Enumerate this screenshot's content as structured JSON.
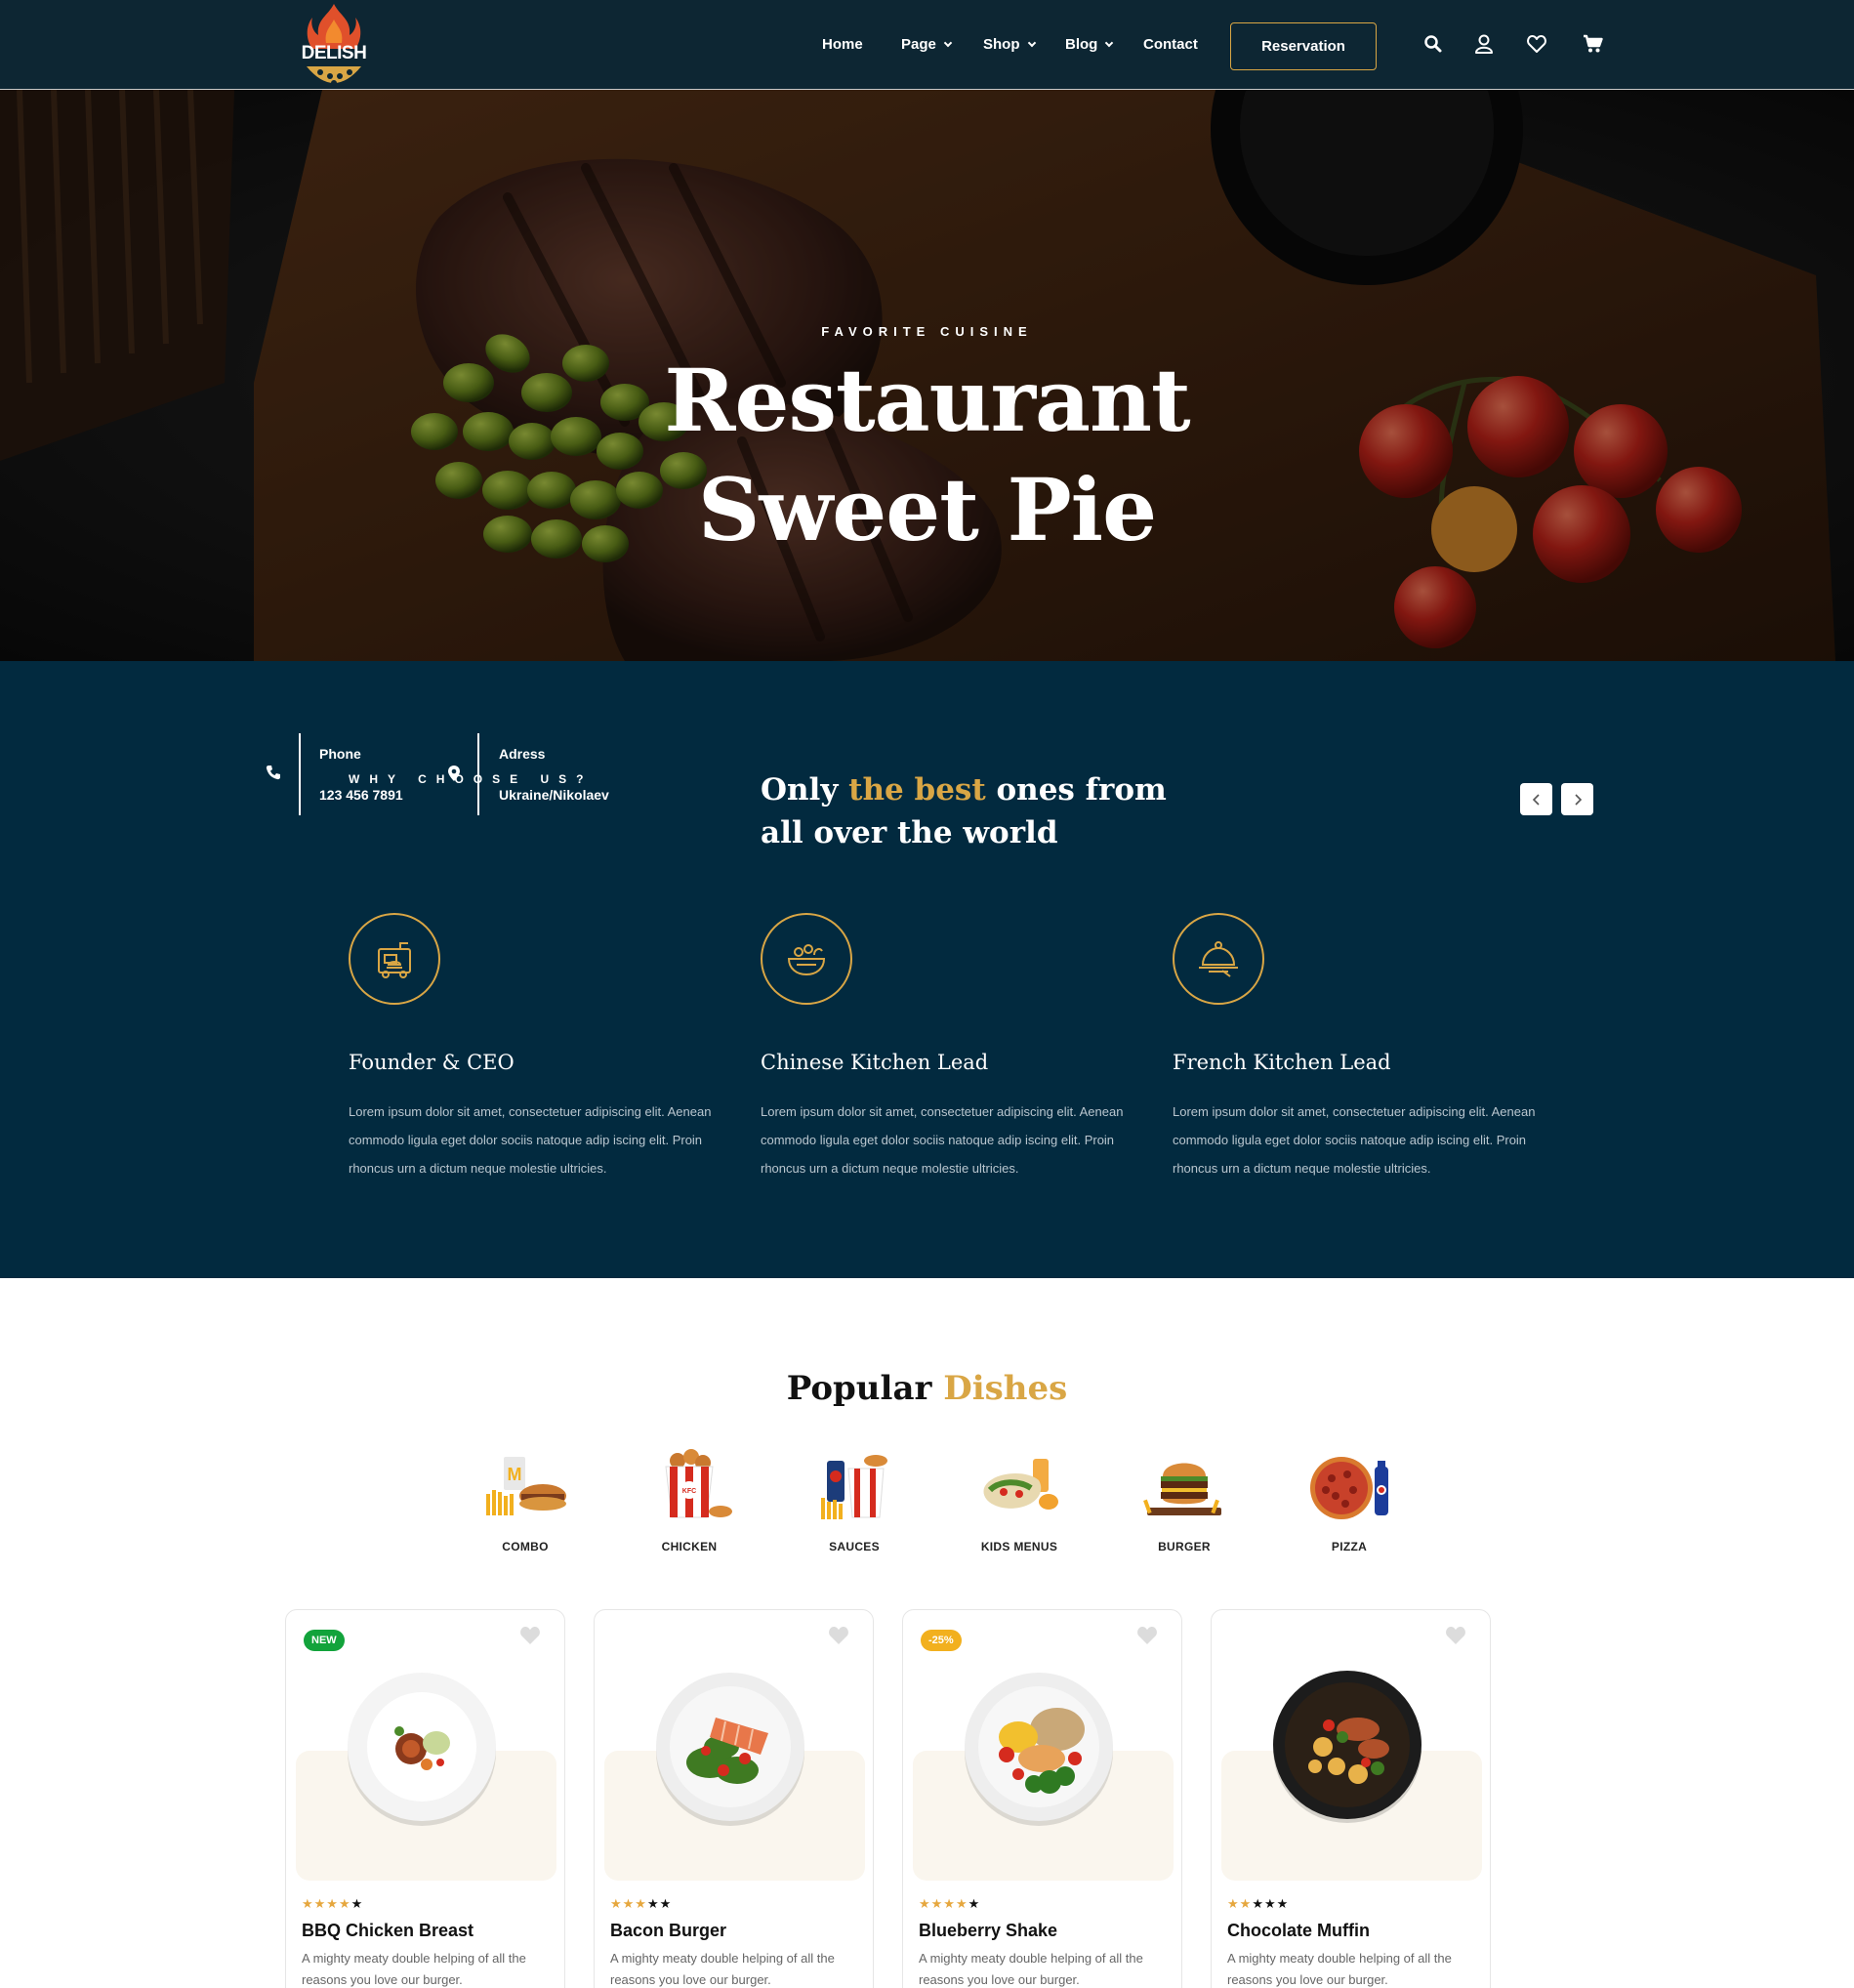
{
  "brand": {
    "logo_text": "DELISH"
  },
  "nav": {
    "items": [
      {
        "label": "Home",
        "has_dropdown": false
      },
      {
        "label": "Page",
        "has_dropdown": true
      },
      {
        "label": "Shop",
        "has_dropdown": true
      },
      {
        "label": "Blog",
        "has_dropdown": true
      },
      {
        "label": "Contact",
        "has_dropdown": false
      }
    ],
    "reservation_label": "Reservation",
    "icons": [
      "search-icon",
      "user-icon",
      "heart-icon",
      "cart-icon"
    ]
  },
  "hero": {
    "eyebrow": "FAVORITE CUISINE",
    "title_line1": "Restaurant",
    "title_line2": "Sweet Pie"
  },
  "why": {
    "eyebrow": "WHY CHOOSE US?",
    "contact": {
      "phone_label": "Phone",
      "phone_value": "123 456 7891",
      "address_label": "Adress",
      "address_value": "Ukraine/Nikolaev"
    },
    "title_part1": "Only",
    "title_accent": "the best",
    "title_part2": "ones from all over the world",
    "features": [
      {
        "title": "Founder & CEO",
        "text": "Lorem ipsum dolor sit amet, consectetuer adipiscing elit. Aenean commodo ligula eget dolor sociis natoque adip iscing elit. Proin rhoncus urn a dictum neque molestie ultricies.",
        "icon": "food-truck-icon"
      },
      {
        "title": "Chinese Kitchen Lead",
        "text": "Lorem ipsum dolor sit amet, consectetuer adipiscing elit. Aenean commodo ligula eget dolor sociis natoque adip iscing elit. Proin rhoncus urn a dictum neque molestie ultricies.",
        "icon": "salad-bowl-icon"
      },
      {
        "title": "French Kitchen Lead",
        "text": "Lorem ipsum dolor sit amet, consectetuer adipiscing elit. Aenean commodo ligula eget dolor sociis natoque adip iscing elit. Proin rhoncus urn a dictum neque molestie ultricies.",
        "icon": "cloche-icon"
      }
    ]
  },
  "popular": {
    "title_part1": "Popular",
    "title_accent": "Dishes",
    "categories": [
      {
        "label": "COMBO"
      },
      {
        "label": "CHICKEN"
      },
      {
        "label": "SAUCES"
      },
      {
        "label": "KIDS MENUS"
      },
      {
        "label": "BURGER"
      },
      {
        "label": "PIZZA"
      }
    ],
    "products": [
      {
        "name": "BBQ Chicken Breast",
        "badge": "NEW",
        "badge_color": "#12a33b",
        "rating": 4,
        "desc": "A mighty meaty double helping of all the reasons you love our burger."
      },
      {
        "name": "Bacon Burger",
        "badge": "",
        "badge_color": "",
        "rating": 3,
        "desc": "A mighty meaty double helping of all the reasons you love our burger."
      },
      {
        "name": "Blueberry Shake",
        "badge": "-25%",
        "badge_color": "#f2b01e",
        "rating": 4,
        "desc": "A mighty meaty double helping of all the reasons you love our burger."
      },
      {
        "name": "Chocolate Muffin",
        "badge": "",
        "badge_color": "",
        "rating": 2,
        "desc": "A mighty meaty double helping of all the reasons you love our burger."
      }
    ]
  },
  "colors": {
    "navy": "#022a3f",
    "header": "#0d2633",
    "gold": "#d9a645"
  }
}
